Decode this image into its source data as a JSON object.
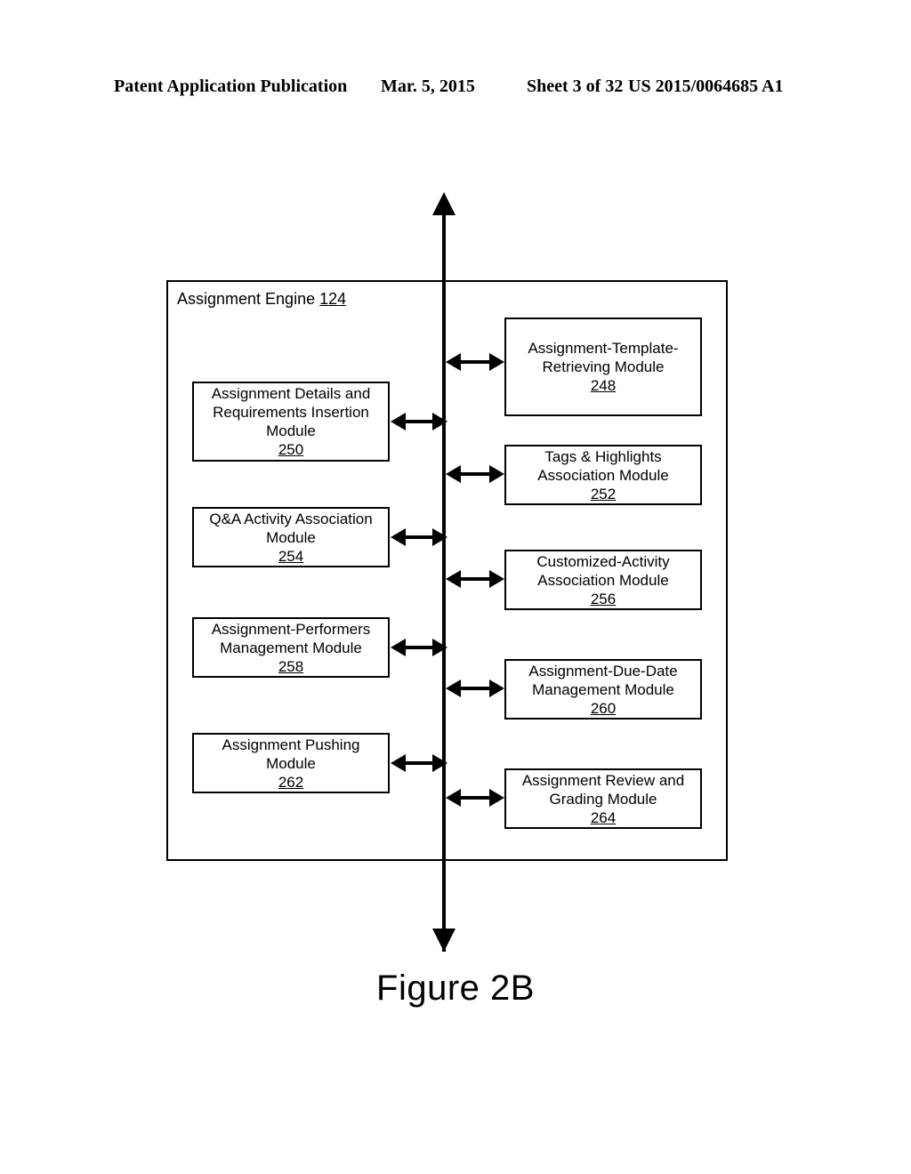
{
  "header": {
    "publication": "Patent Application Publication",
    "date": "Mar. 5, 2015",
    "sheet": "Sheet 3 of 32",
    "patent_number": "US 2015/0064685 A1"
  },
  "figure": {
    "caption": "Figure 2B"
  },
  "diagram": {
    "container": {
      "title": "Assignment Engine",
      "ref": "124"
    },
    "left_modules": [
      {
        "lines": [
          "Assignment Details and",
          "Requirements Insertion",
          "Module"
        ],
        "ref": "250",
        "name": "assignment-details-requirements-insertion-module"
      },
      {
        "lines": [
          "Q&A Activity Association",
          "Module"
        ],
        "ref": "254",
        "name": "qa-activity-association-module"
      },
      {
        "lines": [
          "Assignment-Performers",
          "Management Module"
        ],
        "ref": "258",
        "name": "assignment-performers-management-module"
      },
      {
        "lines": [
          "Assignment Pushing",
          "Module"
        ],
        "ref": "262",
        "name": "assignment-pushing-module"
      }
    ],
    "right_modules": [
      {
        "lines": [
          "Assignment-Template-",
          "Retrieving Module"
        ],
        "ref": "248",
        "name": "assignment-template-retrieving-module"
      },
      {
        "lines": [
          "Tags & Highlights",
          "Association Module"
        ],
        "ref": "252",
        "name": "tags-highlights-association-module"
      },
      {
        "lines": [
          "Customized-Activity",
          "Association Module"
        ],
        "ref": "256",
        "name": "customized-activity-association-module"
      },
      {
        "lines": [
          "Assignment-Due-Date",
          "Management Module"
        ],
        "ref": "260",
        "name": "assignment-due-date-management-module"
      },
      {
        "lines": [
          "Assignment Review and",
          "Grading Module"
        ],
        "ref": "264",
        "name": "assignment-review-grading-module"
      }
    ]
  }
}
